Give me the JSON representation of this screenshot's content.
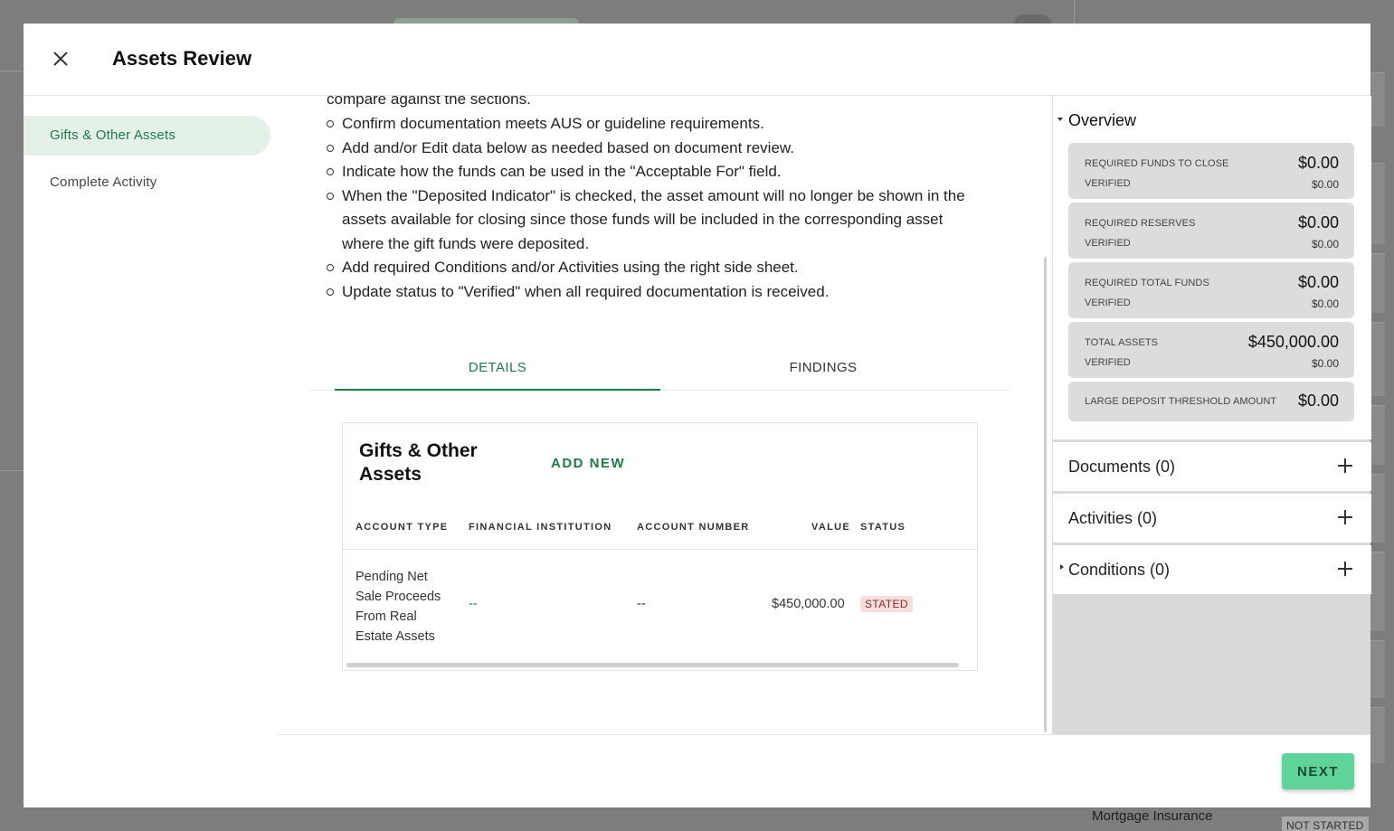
{
  "modal": {
    "title": "Assets Review",
    "close_icon": "close-icon"
  },
  "nav": {
    "items": [
      {
        "label": "Gifts & Other Assets",
        "active": true
      },
      {
        "label": "Complete Activity",
        "active": false
      }
    ]
  },
  "instructions": {
    "intro_tail": "compare against the sections.",
    "bullets": [
      "Confirm documentation meets AUS or guideline requirements.",
      "Add and/or Edit data below as needed based on document review.",
      "Indicate how the funds can be used in the \"Acceptable For\" field.",
      "When the \"Deposited Indicator\" is checked, the asset amount will no longer be shown in the assets available for closing since those funds will be included in the corresponding asset where the gift funds were deposited.",
      "Add required Conditions and/or Activities using the right side sheet.",
      "Update status to \"Verified\" when all required documentation is received."
    ]
  },
  "tabs": {
    "details": "DETAILS",
    "findings": "FINDINGS",
    "active": "details"
  },
  "assets_card": {
    "title": "Gifts & Other Assets",
    "add_new": "ADD NEW",
    "columns": [
      "ACCOUNT TYPE",
      "FINANCIAL INSTITUTION",
      "ACCOUNT NUMBER",
      "VALUE",
      "STATUS"
    ],
    "rows": [
      {
        "account_type": "Pending Net Sale Proceeds From Real Estate Assets",
        "institution": "--",
        "account_number": "--",
        "value": "$450,000.00",
        "status": "STATED"
      }
    ]
  },
  "overview": {
    "title": "Overview",
    "metrics": [
      {
        "label": "REQUIRED FUNDS TO CLOSE",
        "value": "$0.00",
        "verified_label": "VERIFIED",
        "verified": "$0.00"
      },
      {
        "label": "REQUIRED RESERVES",
        "value": "$0.00",
        "verified_label": "VERIFIED",
        "verified": "$0.00"
      },
      {
        "label": "REQUIRED TOTAL FUNDS",
        "value": "$0.00",
        "verified_label": "VERIFIED",
        "verified": "$0.00"
      },
      {
        "label": "TOTAL ASSETS",
        "value": "$450,000.00",
        "verified_label": "VERIFIED",
        "verified": "$0.00"
      },
      {
        "label": "LARGE DEPOSIT THRESHOLD AMOUNT",
        "value": "$0.00"
      }
    ]
  },
  "side_sections": {
    "documents": "Documents (0)",
    "activities": "Activities (0)",
    "conditions": "Conditions (0)"
  },
  "footer": {
    "next": "NEXT"
  },
  "background": {
    "mortgage_insurance": "Mortgage Insurance",
    "not_started": "NOT STARTED"
  },
  "colors": {
    "accent": "#1e7a4a",
    "next_button": "#5fd39a",
    "status_stated_bg": "#f6dede"
  }
}
